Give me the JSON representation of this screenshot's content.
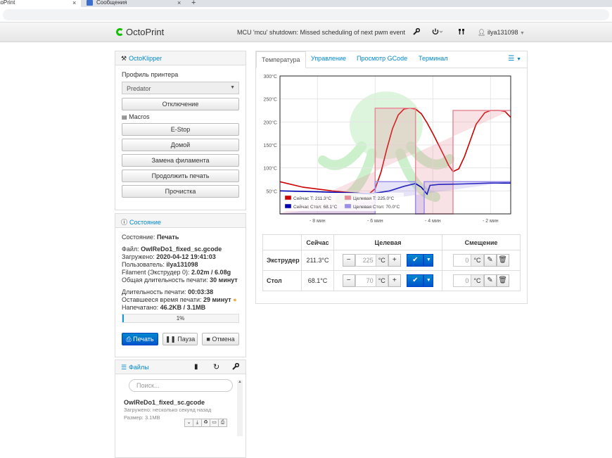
{
  "browser": {
    "tabs": [
      {
        "title": "OctoPrint",
        "close": "×"
      },
      {
        "title": "Сообщения",
        "close": "×"
      }
    ],
    "new_tab": "+"
  },
  "navbar": {
    "brand": "OctoPrint",
    "message": "MCU 'mcu' shutdown: Missed scheduling of next pwm event",
    "user": "ilya131098"
  },
  "klipper": {
    "title": "OctoKlipper",
    "profile_label": "Профиль принтера",
    "profile_value": "Predator",
    "disconnect_label": "Отключение",
    "macros_label": "Macros",
    "macros": [
      "E-Stop",
      "Домой",
      "Замена филамента",
      "Продолжить печать",
      "Прочистка"
    ]
  },
  "state": {
    "title": "Состояние",
    "status_label": "Состояние:",
    "status_value": "Печать",
    "file_label": "Файл:",
    "file_value": "OwlReDo1_fixed_sc.gcode",
    "loaded_label": "Загружено:",
    "loaded_value": "2020-04-12 19:41:03",
    "user_label": "Пользователь:",
    "user_value": "ilya131098",
    "filament_label": "Filament (Экструдер 0):",
    "filament_value": "2.02m / 6.08g",
    "total_label": "Общая длительность печати:",
    "total_value": "30 минут",
    "elapsed_label": "Длительность печати:",
    "elapsed_value": "00:03:38",
    "left_label": "Оставшееся время печати:",
    "left_value": "29 минут",
    "printed_label": "Напечатано:",
    "printed_value": "46.2KB / 3.1MB",
    "progress": 1,
    "progress_text": "1%",
    "print_label": "Печать",
    "pause_label": "Пауза",
    "cancel_label": "Отмена"
  },
  "files": {
    "title": "Файлы",
    "search_placeholder": "Поиск...",
    "items": [
      {
        "name": "OwlReDo1_fixed_sc.gcode",
        "uploaded": "Загружено: несколько секунд назад",
        "size": "Размер: 3.1MB"
      }
    ]
  },
  "tabs": [
    "Температура",
    "Управление",
    "Просмотр GCode",
    "Терминал"
  ],
  "chart_data": {
    "type": "line",
    "x_unit": "minutes",
    "xlim": [
      -9.3,
      -1.3
    ],
    "ylim": [
      0,
      300
    ],
    "y_ticks": [
      "300°C",
      "250°C",
      "200°C",
      "150°C",
      "100°C",
      "50°C"
    ],
    "y_tick_values": [
      300,
      250,
      200,
      150,
      100,
      50
    ],
    "x_ticks": [
      "- 8 мин",
      "- 6 мин",
      "- 4 мин",
      "- 2 мин"
    ],
    "x_tick_values": [
      -8,
      -6,
      -4,
      -2
    ],
    "series": [
      {
        "name": "Сейчас T: 211.3°C",
        "color": "#cc0000",
        "x": [
          -9.3,
          -8.5,
          -7.5,
          -7,
          -6.4,
          -6.2,
          -6,
          -5.8,
          -5.6,
          -5.4,
          -5.2,
          -5.0,
          -4.8,
          -4.6,
          -4.4,
          -4.2,
          -4.0,
          -3.8,
          -3.6,
          -3.45,
          -3.3,
          -3.1,
          -2.9,
          -2.7,
          -2.5,
          -2.2,
          -2.0,
          -1.7,
          -1.5,
          -1.3
        ],
        "y": [
          70,
          58,
          50,
          47,
          44,
          44,
          55,
          90,
          140,
          185,
          215,
          228,
          230,
          228,
          218,
          198,
          175,
          150,
          125,
          105,
          92,
          98,
          125,
          160,
          195,
          220,
          225,
          225,
          223,
          210
        ]
      },
      {
        "name": "Целевая T: 225.0°C",
        "color": "#e88c99",
        "x": [
          -9.3,
          -6.0,
          -6.0,
          -4.6,
          -4.6,
          -3.3,
          -3.3,
          -1.3
        ],
        "y": [
          0,
          0,
          230,
          230,
          0,
          0,
          225,
          225
        ]
      },
      {
        "name": "Сейчас Стол: 68.1°C",
        "color": "#0000b3",
        "x": [
          -9.3,
          -8,
          -7,
          -6.2,
          -6.0,
          -5.5,
          -5,
          -4.6,
          -4.4,
          -4.2,
          -4.1,
          -3.8,
          -3,
          -2,
          -1.3
        ],
        "y": [
          50,
          48,
          46,
          44,
          45,
          50,
          60,
          66,
          58,
          43,
          62,
          64,
          65,
          67,
          67
        ]
      },
      {
        "name": "Целевая Стол: 70.0°C",
        "color": "#9a8fe8",
        "x": [
          -9.3,
          -6.0,
          -6.0,
          -4.6,
          -4.6,
          -4.3,
          -4.3,
          -1.3
        ],
        "y": [
          0,
          0,
          70,
          70,
          0,
          0,
          70,
          70
        ]
      }
    ]
  },
  "temp_table": {
    "headers": [
      "",
      "Сейчас",
      "Целевая",
      "Смещение"
    ],
    "rows": [
      {
        "name": "Экструдер",
        "actual": "211.3°C",
        "target": "225",
        "offset": "0"
      },
      {
        "name": "Стол",
        "actual": "68.1°C",
        "target": "70",
        "offset": "0"
      }
    ],
    "unit": "°C"
  }
}
